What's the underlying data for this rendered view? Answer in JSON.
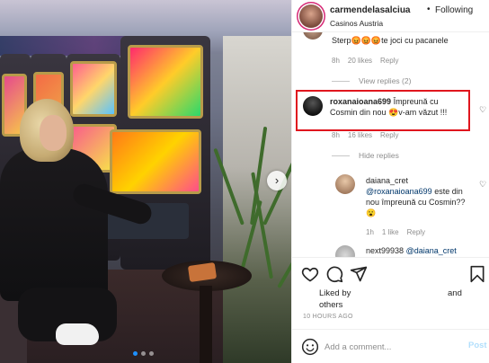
{
  "post_header": {
    "username": "carmendelasalciua",
    "bullet": "•",
    "follow_label": "Following",
    "location": "Casinos Austria"
  },
  "comments": {
    "top_comment": {
      "text": "Sterp😡😡😡te joci cu pacanele",
      "age": "8h",
      "likes": "20 likes",
      "reply": "Reply"
    },
    "view_replies": "View replies (2)",
    "highlighted": {
      "username": "roxanaioana699",
      "text_line1": "Împreună cu",
      "text_line2": "Cosmin din nou 😍v-am văzut !!!",
      "age": "8h",
      "likes": "16 likes",
      "reply": "Reply"
    },
    "hide_replies": "Hide replies",
    "reply_comment": {
      "username": "daiana_cret",
      "mention": "@roxanaioana699",
      "text_after_mention": " este din",
      "text_line2": "nou împreună cu Cosmin??",
      "emoji": "😮",
      "age": "1h",
      "likes": "1 like",
      "reply": "Reply"
    },
    "partial_comment": {
      "username": "next99938",
      "mention": "@daiana_cret"
    }
  },
  "actions": {
    "liked_by_prefix": "Liked by",
    "liked_by_and": "and",
    "liked_by_others": "others",
    "timestamp": "10 HOURS AGO"
  },
  "add_comment": {
    "placeholder": "Add a comment...",
    "post_label": "Post"
  },
  "carousel": {
    "next_symbol": "›",
    "slides": 3,
    "active_index": 0
  },
  "colors": {
    "highlight_border": "#e0161e",
    "mention": "#00376b",
    "muted": "#8e8e8e",
    "post_disabled": "#b2dffc",
    "carousel_active_dot": "#1e90ff"
  },
  "icons": {
    "like": "heart-icon",
    "comment": "comment-bubble-icon",
    "share": "paper-plane-icon",
    "save": "bookmark-icon",
    "emoji": "smiley-icon",
    "carousel_next": "chevron-right-icon"
  }
}
